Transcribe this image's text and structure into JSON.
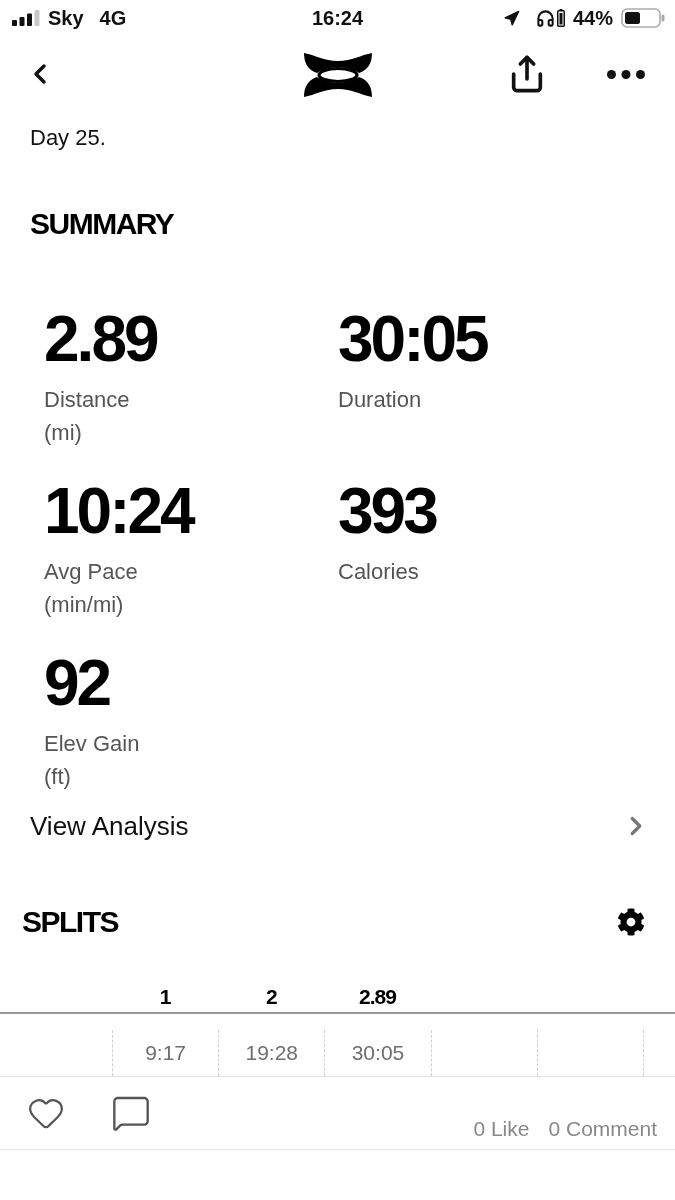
{
  "status_bar": {
    "carrier": "Sky",
    "network": "4G",
    "time": "16:24",
    "battery": "44%"
  },
  "description": "Day 25.",
  "summary": {
    "title": "SUMMARY",
    "stats": [
      {
        "value": "2.89",
        "label": "Distance",
        "unit": "(mi)"
      },
      {
        "value": "30:05",
        "label": "Duration"
      },
      {
        "value": "10:24",
        "label": "Avg Pace",
        "unit": "(min/mi)"
      },
      {
        "value": "393",
        "label": "Calories"
      },
      {
        "value": "92",
        "label": "Elev Gain",
        "unit": "(ft)"
      }
    ]
  },
  "view_analysis": {
    "label": "View Analysis"
  },
  "splits": {
    "title": "SPLITS",
    "columns": [
      "1",
      "2",
      "2.89"
    ],
    "times": [
      "9:17",
      "19:28",
      "30:05"
    ]
  },
  "footer": {
    "likes": "0 Like",
    "comments": "0 Comment"
  }
}
